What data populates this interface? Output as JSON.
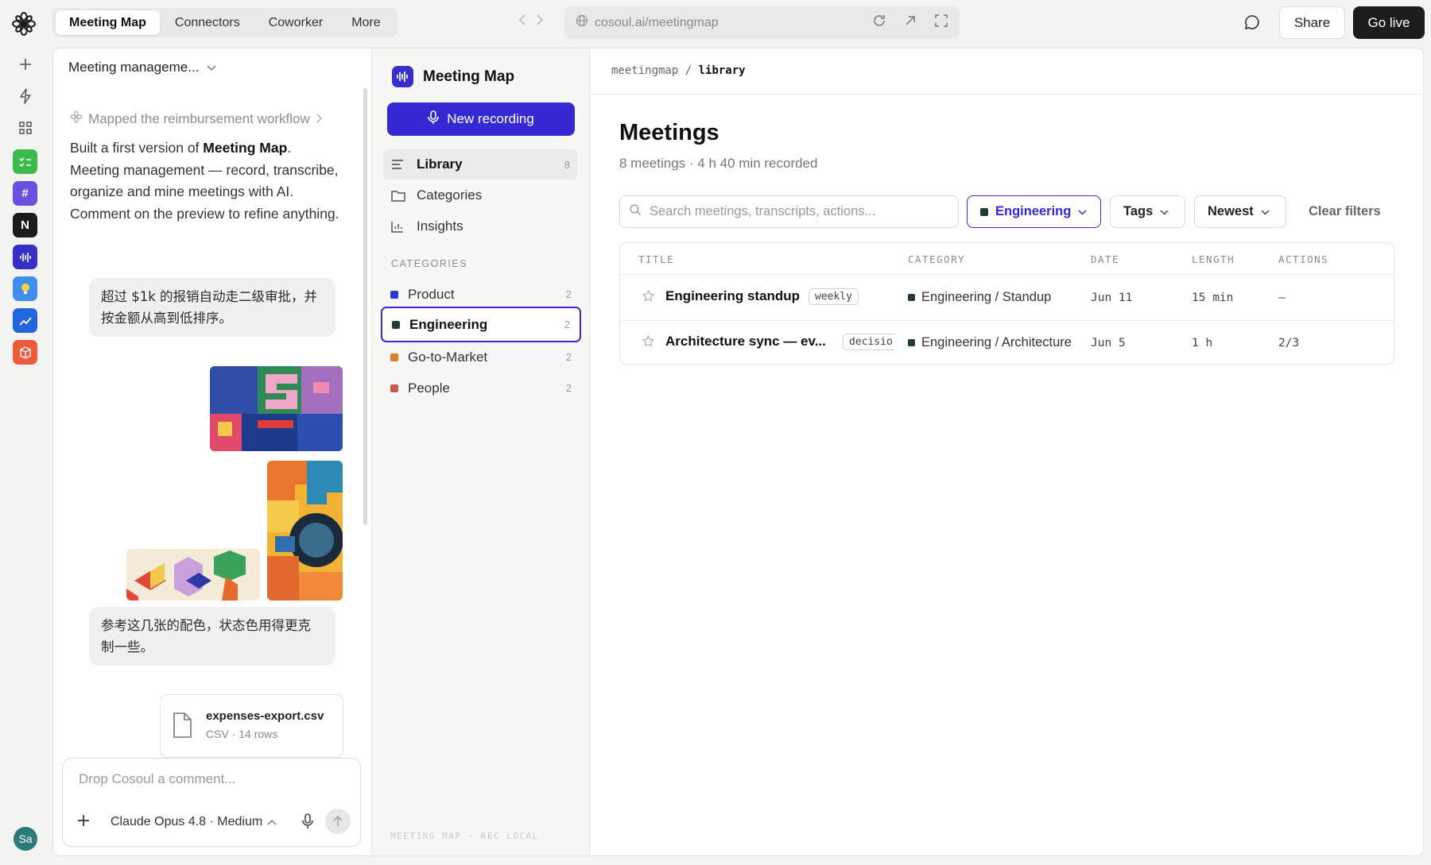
{
  "colors": {
    "accent": "#3529d4",
    "product": "#2f35d6",
    "engineering": "#1f3d33",
    "gtm": "#e07c2a",
    "people": "#c95a4a"
  },
  "topbar": {
    "tabs": [
      {
        "label": "Meeting Map",
        "active": true
      },
      {
        "label": "Connectors",
        "active": false
      },
      {
        "label": "Coworker",
        "active": false
      },
      {
        "label": "More",
        "active": false
      }
    ],
    "url": "cosoul.ai/meetingmap",
    "share_label": "Share",
    "golive_label": "Go live"
  },
  "rail": {
    "avatar_initials": "Sa",
    "apps": [
      "checklist-app",
      "hashtag-app",
      "notion-app",
      "waveform-app",
      "lightbulb-app",
      "chart-app",
      "box-app"
    ]
  },
  "chat": {
    "title": "Meeting manageme...",
    "mapped_text": "Mapped the reimbursement workflow",
    "message_prefix": "Built a first version of ",
    "message_bold": "Meeting Map",
    "message_suffix": ". Meeting management — record, transcribe, organize and mine meetings with AI. Comment on the preview to refine anything.",
    "bubble1": "超过 $1k 的报销自动走二级审批，并按金额从高到低排序。",
    "bubble2": "参考这几张的配色，状态色用得更克制一些。",
    "file": {
      "name": "expenses-export.csv",
      "meta": "CSV · 14 rows"
    },
    "composer_placeholder": "Drop Cosoul a comment...",
    "model_label": "Claude Opus 4.8 · Medium"
  },
  "appside": {
    "brand": "Meeting Map",
    "new_recording": "New recording",
    "nav": [
      {
        "label": "Library",
        "count": "8",
        "icon": "list-icon"
      },
      {
        "label": "Categories",
        "count": "",
        "icon": "folder-icon"
      },
      {
        "label": "Insights",
        "count": "",
        "icon": "bar-chart-icon"
      }
    ],
    "categories_heading": "CATEGORIES",
    "categories": [
      {
        "label": "Product",
        "count": "2"
      },
      {
        "label": "Engineering",
        "count": "2"
      },
      {
        "label": "Go-to-Market",
        "count": "2"
      },
      {
        "label": "People",
        "count": "2"
      }
    ],
    "footer": "MEETING MAP · REC LOCAL"
  },
  "content": {
    "crumb_root": "meetingmap",
    "crumb_sep": " / ",
    "crumb_current": "library",
    "heading": "Meetings",
    "subheading": "8 meetings · 4 h 40 min recorded",
    "search_placeholder": "Search meetings, transcripts, actions...",
    "filter_category": "Engineering",
    "filter_tags": "Tags",
    "filter_sort": "Newest",
    "clear_filters": "Clear filters",
    "columns": [
      "TITLE",
      "CATEGORY",
      "DATE",
      "LENGTH",
      "ACTIONS"
    ],
    "rows": [
      {
        "title": "Engineering standup",
        "tag": "weekly",
        "category": "Engineering / Standup",
        "date": "Jun 11",
        "length": "15 min",
        "actions": "–"
      },
      {
        "title": "Architecture sync — ev...",
        "tag": "decisio",
        "category": "Engineering / Architecture",
        "date": "Jun 5",
        "length": "1 h",
        "actions": "2/3"
      }
    ]
  }
}
